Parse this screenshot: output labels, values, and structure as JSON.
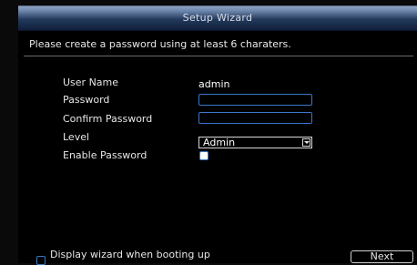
{
  "window": {
    "title": "Setup Wizard",
    "subtitle": "Please create a password using at least 6 charaters."
  },
  "form": {
    "username_label": "User Name",
    "username_value": "admin",
    "password_label": "Password",
    "password_value": "",
    "confirm_label": "Confirm Password",
    "confirm_value": "",
    "level_label": "Level",
    "level_value": "Admin",
    "enable_label": "Enable Password",
    "enable_checked": false
  },
  "footer": {
    "wizard_on_boot_label": "Display wizard when booting up",
    "wizard_on_boot_checked": false,
    "next_label": "Next"
  },
  "colors": {
    "accent": "#3a77c9",
    "background": "#000000"
  }
}
